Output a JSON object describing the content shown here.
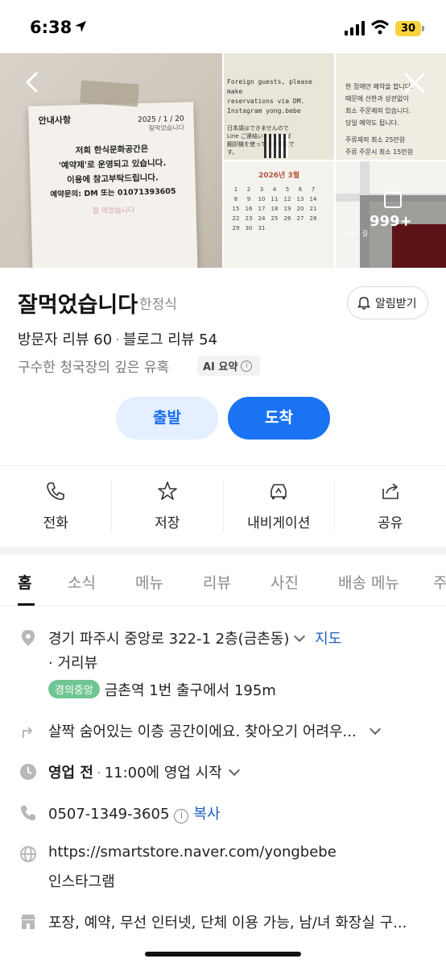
{
  "status_bar": {
    "time": "6:38",
    "battery": "30"
  },
  "photos": {
    "more_count": "999+",
    "note": {
      "heading": "안내사항",
      "date": "2025 / 1 / 20",
      "signed": "잘먹었습니다",
      "lines": [
        "저희 한식문화공간은",
        "'예약제'로 운영되고 있습니다.",
        "이용에 참고부탁드립니다.",
        "예약문의: DM 또는 01071393605"
      ],
      "brand": "잘 먹었습니다"
    },
    "notice_en": [
      "Foreign guests, please make",
      "reservations via DM.",
      "Instagram yong.bebe"
    ],
    "notice_jp": "日本語はできませんので Line ご連絡いただければ翻訳機を使って会話可能です。",
    "notice_kr": [
      "한 접에만 예약을 합니다.",
      "때문에 선한과 상관없이",
      "최소 주문제의 있습니다.",
      "당일 예약도 됩니다.",
      "주류제외 최소 25만원",
      "주류 주문시 최소 15만원"
    ],
    "calendar_title": "2026년 3월",
    "calendar_days": [
      "1",
      "2",
      "3",
      "4",
      "5",
      "6",
      "7",
      "8",
      "9",
      "10",
      "11",
      "12",
      "13",
      "14",
      "15",
      "16",
      "17",
      "18",
      "19",
      "20",
      "21",
      "22",
      "23",
      "24",
      "25",
      "26",
      "27",
      "28",
      "29",
      "30",
      "31"
    ],
    "map_caption": "오시는 길"
  },
  "place": {
    "name": "잘먹었습니다",
    "category": "한정식",
    "alarm_label": "알림받기",
    "visitor_reviews": "방문자 리뷰 60",
    "blog_reviews": "블로그 리뷰 54",
    "summary": "구수한 청국장의 깊은 유혹",
    "ai_badge": "AI 요약"
  },
  "route": {
    "depart": "출발",
    "arrive": "도착"
  },
  "actions": [
    "전화",
    "저장",
    "내비게이션",
    "공유"
  ],
  "tabs": [
    "홈",
    "소식",
    "메뉴",
    "리뷰",
    "사진",
    "배송 메뉴",
    "주"
  ],
  "info": {
    "address": "경기 파주시 중앙로 322-1 2층(금촌동)",
    "map_link": "지도",
    "street_view": "거리뷰",
    "subway_line": "경의중앙",
    "subway_dir": "금촌역 1번 출구에서 195m",
    "directions": "살짝 숨어있는 이층 공간이에요. 찾아오기 어려우...",
    "hours_status": "영업 전",
    "hours_detail": "11:00에 영업 시작",
    "phone": "0507-1349-3605",
    "copy": "복사",
    "url": "https://smartstore.naver.com/yongbebe",
    "instagram": "인스타그램",
    "amenities": "포장, 예약, 무선 인터넷, 단체 이용 가능, 남/녀 화장실 구..."
  },
  "colors": {
    "accent": "#1a73f2",
    "accent_soft": "#e4efff",
    "subway": "#70c593",
    "link": "#1a5fbf"
  }
}
